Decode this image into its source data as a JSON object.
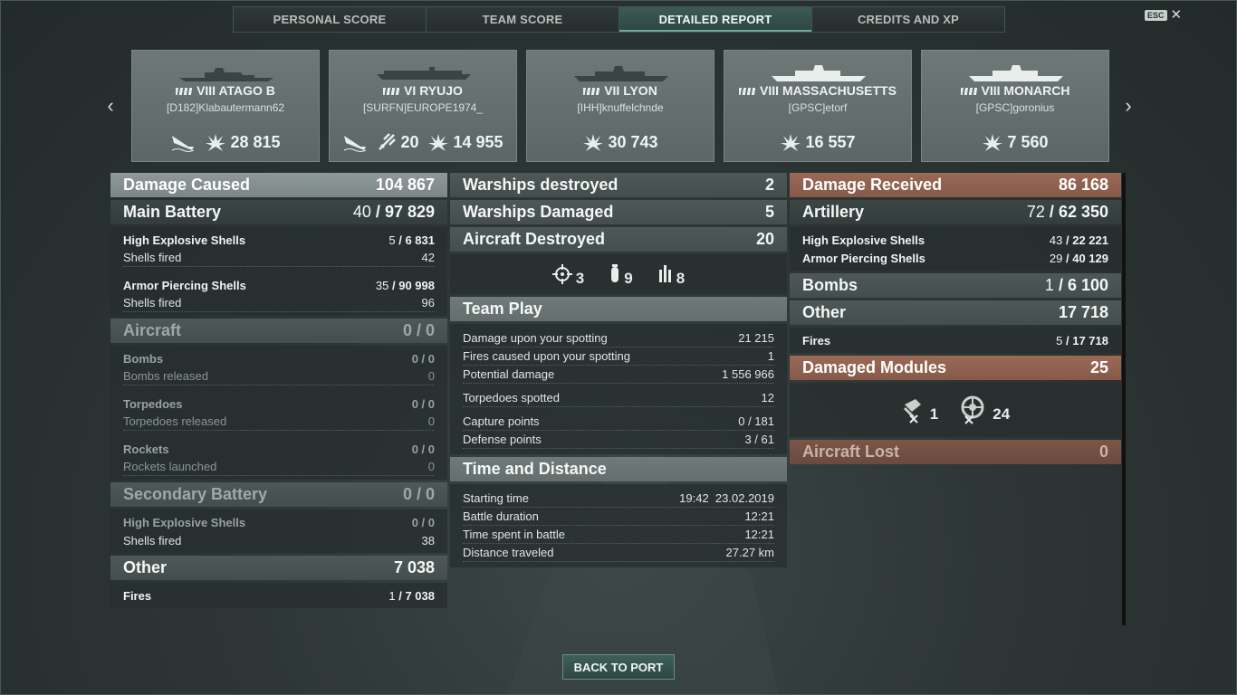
{
  "tabs": [
    "PERSONAL SCORE",
    "TEAM SCORE",
    "DETAILED REPORT",
    "CREDITS AND XP"
  ],
  "esc_label": "ESC",
  "ships": [
    {
      "name": "VIII ATAGO B",
      "player": "[D182]Klabautermann62",
      "damage": "28 815"
    },
    {
      "name": "VI RYUJO",
      "player": "[SURFN]EUROPE1974_",
      "planes": "20",
      "damage": "14 955"
    },
    {
      "name": "VII LYON",
      "player": "[IHH]knuffelchnde",
      "damage": "30 743"
    },
    {
      "name": "VIII MASSACHUSETTS",
      "player": "[GPSC]etorf",
      "damage": "16 557"
    },
    {
      "name": "VIII MONARCH",
      "player": "[GPSC]goronius",
      "damage": "7 560"
    }
  ],
  "left": {
    "damage_caused": {
      "label": "Damage Caused",
      "value": "104 867"
    },
    "main_battery": {
      "label": "Main Battery",
      "hits": "40",
      "value": "97 829"
    },
    "he": {
      "label": "High Explosive Shells",
      "hits": "5",
      "value": "6 831",
      "fired_label": "Shells fired",
      "fired": "42"
    },
    "ap": {
      "label": "Armor Piercing Shells",
      "hits": "35",
      "value": "90 998",
      "fired_label": "Shells fired",
      "fired": "96"
    },
    "aircraft": {
      "label": "Aircraft",
      "hits": "0",
      "value": "0"
    },
    "bombs": {
      "label": "Bombs",
      "hits": "0",
      "value": "0",
      "sub_label": "Bombs released",
      "sub": "0"
    },
    "torpedoes": {
      "label": "Torpedoes",
      "hits": "0",
      "value": "0",
      "sub_label": "Torpedoes released",
      "sub": "0"
    },
    "rockets": {
      "label": "Rockets",
      "hits": "0",
      "value": "0",
      "sub_label": "Rockets launched",
      "sub": "0"
    },
    "secondary": {
      "label": "Secondary Battery",
      "hits": "0",
      "value": "0"
    },
    "sec_he": {
      "label": "High Explosive Shells",
      "hits": "0",
      "value": "0",
      "fired_label": "Shells fired",
      "fired": "38"
    },
    "other": {
      "label": "Other",
      "value": "7 038"
    },
    "fires": {
      "label": "Fires",
      "hits": "1",
      "value": "7 038"
    }
  },
  "middle": {
    "warships_destroyed": {
      "label": "Warships destroyed",
      "value": "2"
    },
    "warships_damaged": {
      "label": "Warships Damaged",
      "value": "5"
    },
    "aircraft_destroyed": {
      "label": "Aircraft Destroyed",
      "value": "20"
    },
    "aircraft_icons": {
      "fighter": "3",
      "bomber": "9",
      "rocket": "8"
    },
    "team_play": {
      "title": "Team Play",
      "rows": [
        {
          "label": "Damage upon your spotting",
          "value": "21 215"
        },
        {
          "label": "Fires caused upon your spotting",
          "value": "1"
        },
        {
          "label": "Potential damage",
          "value": "1 556 966"
        },
        {
          "label": "Torpedoes spotted",
          "value": "12"
        },
        {
          "label": "Capture points",
          "value": "0 / 181"
        },
        {
          "label": "Defense points",
          "value": "3 / 61"
        }
      ]
    },
    "time_distance": {
      "title": "Time and Distance",
      "rows": [
        {
          "label": "Starting time",
          "value": "19:42  23.02.2019"
        },
        {
          "label": "Battle duration",
          "value": "12:21"
        },
        {
          "label": "Time spent in battle",
          "value": "12:21"
        },
        {
          "label": "Distance traveled",
          "value": "27.27 km"
        }
      ]
    }
  },
  "right": {
    "damage_received": {
      "label": "Damage Received",
      "value": "86 168"
    },
    "artillery": {
      "label": "Artillery",
      "hits": "72",
      "value": "62 350"
    },
    "he": {
      "label": "High Explosive Shells",
      "hits": "43",
      "value": "22 221"
    },
    "ap": {
      "label": "Armor Piercing Shells",
      "hits": "29",
      "value": "40 129"
    },
    "bombs": {
      "label": "Bombs",
      "hits": "1",
      "value": "6 100"
    },
    "other": {
      "label": "Other",
      "value": "17 718"
    },
    "fires": {
      "label": "Fires",
      "hits": "5",
      "value": "17 718"
    },
    "damaged_modules": {
      "label": "Damaged Modules",
      "value": "25"
    },
    "module_icons": {
      "turret": "1",
      "engine": "24"
    },
    "aircraft_lost": {
      "label": "Aircraft Lost",
      "value": "0"
    }
  },
  "back_button": "BACK TO PORT"
}
